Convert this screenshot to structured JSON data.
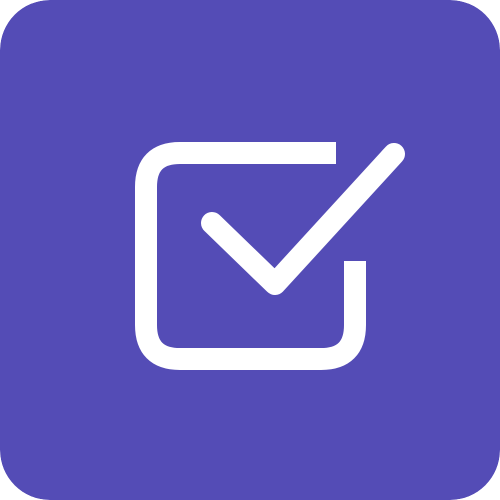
{
  "icon": {
    "name": "checkbox-checked-icon",
    "background_color": "#544cb6",
    "glyph_color": "#ffffff"
  }
}
